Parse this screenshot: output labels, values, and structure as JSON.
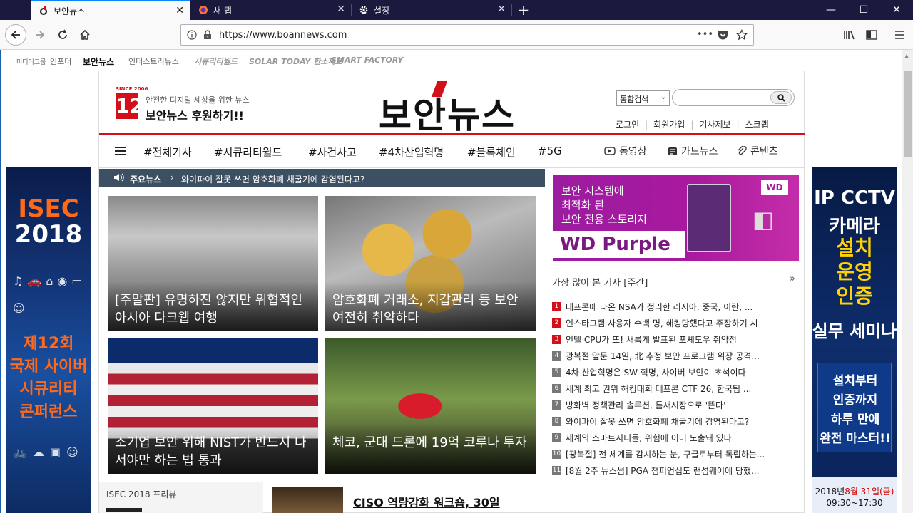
{
  "browser": {
    "tabs": [
      {
        "label": "보안뉴스",
        "active": true
      },
      {
        "label": "새 탭",
        "active": false
      },
      {
        "label": "설정",
        "active": false
      }
    ],
    "url": "https://www.boannews.com",
    "window_controls": {
      "minimize": "—",
      "maximize": "☐",
      "close": "✕"
    },
    "close_glyph": "✕",
    "new_tab_glyph": "+",
    "page_actions": "•••"
  },
  "topstrip": {
    "items": [
      "미디어그룹",
      "인포더",
      "보안뉴스",
      "인더스트리뉴스",
      "시큐리티월드",
      "SOLAR TODAY 한소제로",
      "SMART FACTORY"
    ]
  },
  "header": {
    "since": "SINCE 2006",
    "anniversary": "12",
    "tagline": "안전한 디지털 세상을 위한 뉴스",
    "support": "보안뉴스 후원하기!!",
    "logo": "보안뉴스",
    "search_select": "통합검색",
    "util_links": [
      "로그인",
      "회원가입",
      "기사제보",
      "스크랩"
    ]
  },
  "nav": {
    "categories": [
      "#전체기사",
      "#시큐리티월드",
      "#사건사고",
      "#4차산업혁명",
      "#블록체인",
      "#5G"
    ],
    "right_links": [
      "동영상",
      "카드뉴스",
      "콘텐츠"
    ]
  },
  "ticker": {
    "label": "주요뉴스",
    "arrow": "›",
    "text": "와이파이 잘못 쓰면 암호화폐 채굴기에 감염된다고?"
  },
  "cards": [
    {
      "title": "[주말판] 유명하진 않지만 위협적인 아시아 다크웹 여행"
    },
    {
      "title": "암호화폐 거래소, 지갑관리 등 보안 여전히 취약하다"
    },
    {
      "title": "소기업 보안 위해 NIST가 반드시 나서야만 하는 법 통과"
    },
    {
      "title": "체코, 군대 드론에 19억 코루나 투자"
    }
  ],
  "preview": {
    "label": "ISEC 2018 프리뷰",
    "ciso": "CISO 역량강화 워크숍, 30일"
  },
  "ad_wd": {
    "text": [
      "보안 시스템에",
      "최적화 된",
      "보안 전용 스토리지"
    ],
    "brand": "WD Purple",
    "logo": "WD"
  },
  "popular": {
    "heading": "가장 많이 본 기사 [주간]",
    "more": "»",
    "items": [
      "데프콘에 나온 NSA가 정리한 러시아, 중국, 이란, ...",
      "인스타그램 사용자 수백 명, 해킹당했다고 주장하기 시",
      "인텔 CPU가 또! 새롭게 발표된 포셰도우 취약점",
      "광복절 앞둔 14일, 北 추정 보안 프로그램 위장 공격...",
      "4차 산업혁명은 SW 혁명, 사이버 보안이 초석이다",
      "세계 최고 권위 해킹대회 데프콘 CTF 26, 한국팀 ...",
      "방화벽 정책관리 솔루션, 틈새시장으로 '뜬다'",
      "와이파이 잘못 쓰면 암호화폐 채굴기에 감염된다고?",
      "세계의 스마트시티들, 위험에 이미 노출돼 있다",
      "[광복절] 전 세계를 감시하는 눈, 구글로부터 독립하는...",
      "[8월 2주 뉴스썸] PGA 챔피언십도 랜섬웨어에 당했..."
    ]
  },
  "banner_left": {
    "title": "ISEC",
    "year": "2018",
    "sub": [
      "제12회",
      "국제 사이버",
      "시큐리티",
      "콘퍼런스"
    ]
  },
  "banner_right": {
    "t1": "IP CCTV",
    "t2": "카메라",
    "t3": [
      "설치",
      "운영",
      "인증"
    ],
    "t4": "실무 세미나",
    "box": [
      "설치부터",
      "인증까지",
      "하루 만에",
      "완전 마스터!!"
    ],
    "date_prefix": "2018년",
    "date_hl": "8월 31일(금)",
    "time": "09:30~17:30"
  }
}
